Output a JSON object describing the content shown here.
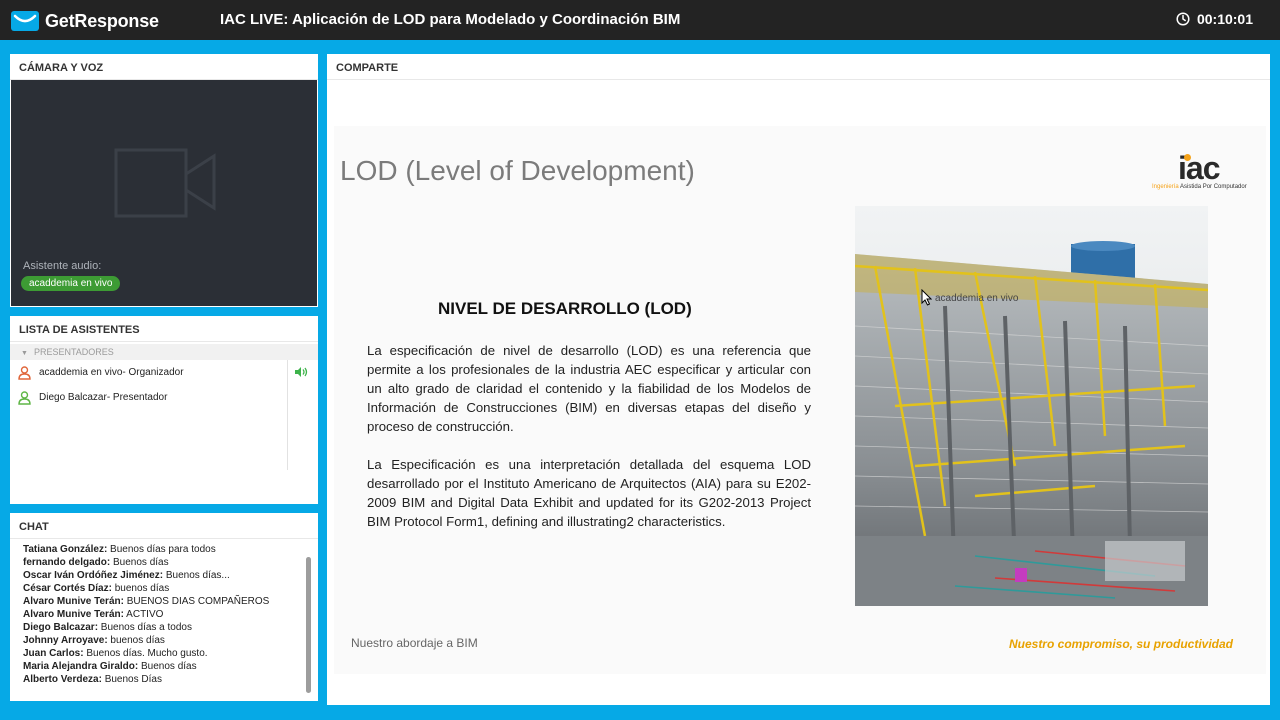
{
  "header": {
    "brand": "GetResponse",
    "title": "IAC LIVE: Aplicación de LOD para Modelado y Coordinación BIM",
    "timer": "00:10:01"
  },
  "camera": {
    "heading": "CÁMARA Y VOZ",
    "audio_label": "Asistente audio:",
    "audio_user": "acaddemia en vivo"
  },
  "attendees": {
    "heading": "LISTA DE ASISTENTES",
    "group": "PRESENTADORES",
    "people": [
      {
        "name": "acaddemia en vivo",
        "role": " - Organizador"
      },
      {
        "name": "Diego Balcazar",
        "role": " - Presentador"
      }
    ]
  },
  "chat": {
    "heading": "CHAT",
    "messages": [
      {
        "name": "Tatiana González:",
        "text": " Buenos días para todos"
      },
      {
        "name": "fernando delgado:",
        "text": " Buenos días"
      },
      {
        "name": "Oscar Iván Ordóñez Jiménez:",
        "text": " Buenos días..."
      },
      {
        "name": "César Cortés Díaz:",
        "text": " buenos días"
      },
      {
        "name": "Alvaro Munive Terán:",
        "text": " BUENOS DIAS COMPAÑEROS"
      },
      {
        "name": "Alvaro Munive Terán:",
        "text": " ACTIVO"
      },
      {
        "name": "Diego Balcazar:",
        "text": " Buenos días a todos"
      },
      {
        "name": "Johnny Arroyave:",
        "text": " buenos días"
      },
      {
        "name": "Juan Carlos:",
        "text": " Buenos días. Mucho gusto."
      },
      {
        "name": "Maria Alejandra Giraldo:",
        "text": " Buenos días"
      },
      {
        "name": "Alberto Verdeza:",
        "text": " Buenos Días"
      }
    ]
  },
  "share": {
    "heading": "COMPARTE",
    "slide": {
      "title": "LOD (Level of Development)",
      "logo_text": "iac",
      "logo_sub_1": "Ingeniería",
      "logo_sub_2": " Asistida Por Computador",
      "heading": "NIVEL DE DESARROLLO (LOD)",
      "para1": "La especificación de nivel de desarrollo (LOD) es una referencia que permite a los profesionales de la industria AEC especificar y articular con un alto grado de claridad el contenido y la fiabilidad de los Modelos de Información de Construcciones (BIM) en diversas etapas del diseño y proceso de construcción.",
      "para2": "La Especificación es una interpretación detallada del esquema LOD desarrollado por el Instituto Americano de Arquitectos (AIA) para su E202-2009 BIM and Digital Data Exhibit and updated for its G202-2013 Project BIM Protocol Form1, defining and illustrating2 characteristics.",
      "footer_left": "Nuestro abordaje a BIM",
      "footer_right": "Nuestro compromiso, su productividad"
    },
    "cursor_label": "acaddemia en vivo"
  },
  "colors": {
    "background": "#06a9e6",
    "topbar": "#232323",
    "audio_chip": "#3d9b34",
    "footer_accent": "#e8a200"
  }
}
